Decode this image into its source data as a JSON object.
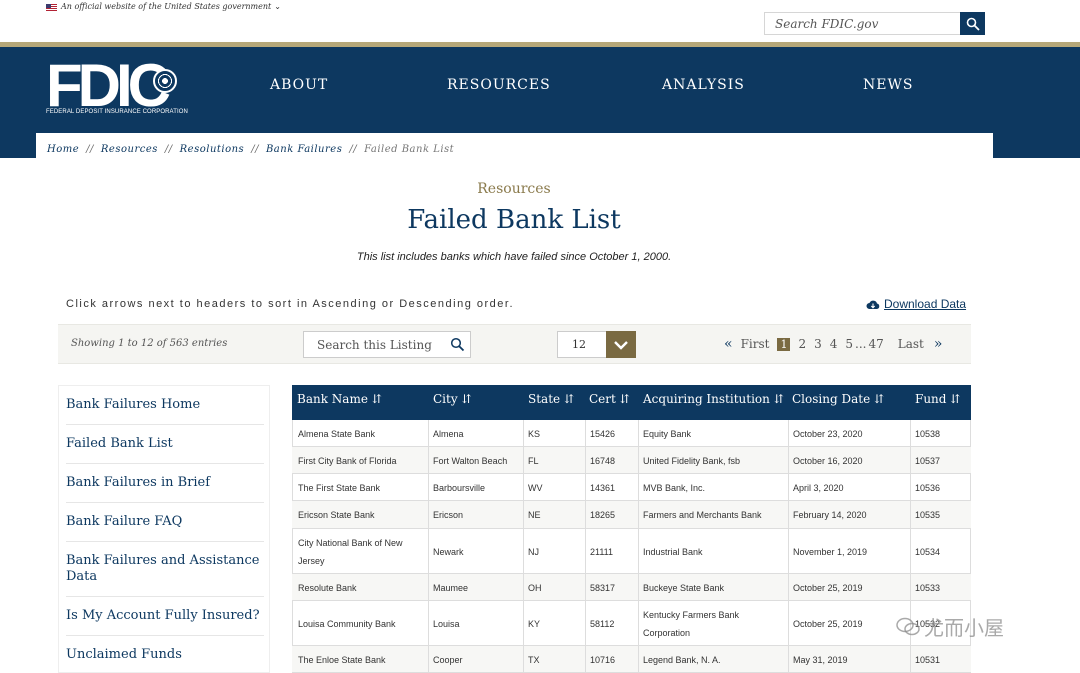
{
  "gov_banner": {
    "text": "An official website of the United States government"
  },
  "site_search": {
    "placeholder": "Search FDIC.gov"
  },
  "logo": {
    "letters": "FDIC",
    "subtitle": "FEDERAL DEPOSIT INSURANCE CORPORATION"
  },
  "nav": [
    "ABOUT",
    "RESOURCES",
    "ANALYSIS",
    "NEWS"
  ],
  "breadcrumb": [
    "Home",
    "Resources",
    "Resolutions",
    "Bank Failures",
    "Failed Bank List"
  ],
  "eyebrow": "Resources",
  "title": "Failed Bank List",
  "intro": "This list includes banks which have failed since October 1, 2000.",
  "sort_note": "Click arrows next to headers to sort in Ascending or Descending order.",
  "download_label": "Download Data",
  "showing": "Showing 1 to 12 of 563 entries",
  "listing_search": {
    "placeholder": "Search this Listing"
  },
  "per_page": "12",
  "pager": {
    "first": "First",
    "pages": [
      "1",
      "2",
      "3",
      "4",
      "5"
    ],
    "ellipsis": "...",
    "last_page": "47",
    "last": "Last"
  },
  "sidebar": [
    "Bank Failures Home",
    "Failed Bank List",
    "Bank Failures in Brief",
    "Bank Failure FAQ",
    "Bank Failures and Assistance Data",
    "Is My Account Fully Insured?",
    "Unclaimed Funds"
  ],
  "table": {
    "headers": [
      "Bank Name",
      "City",
      "State",
      "Cert",
      "Acquiring Institution",
      "Closing Date",
      "Fund"
    ],
    "rows": [
      [
        "Almena State Bank",
        "Almena",
        "KS",
        "15426",
        "Equity Bank",
        "October 23, 2020",
        "10538"
      ],
      [
        "First City Bank of Florida",
        "Fort Walton Beach",
        "FL",
        "16748",
        "United Fidelity Bank, fsb",
        "October 16, 2020",
        "10537"
      ],
      [
        "The First State Bank",
        "Barboursville",
        "WV",
        "14361",
        "MVB Bank, Inc.",
        "April 3, 2020",
        "10536"
      ],
      [
        "Ericson State Bank",
        "Ericson",
        "NE",
        "18265",
        "Farmers and Merchants Bank",
        "February 14, 2020",
        "10535"
      ],
      [
        "City National Bank of New Jersey",
        "Newark",
        "NJ",
        "21111",
        "Industrial Bank",
        "November 1, 2019",
        "10534"
      ],
      [
        "Resolute Bank",
        "Maumee",
        "OH",
        "58317",
        "Buckeye State Bank",
        "October 25, 2019",
        "10533"
      ],
      [
        "Louisa Community Bank",
        "Louisa",
        "KY",
        "58112",
        "Kentucky Farmers Bank Corporation",
        "October 25, 2019",
        "10532"
      ],
      [
        "The Enloe State Bank",
        "Cooper",
        "TX",
        "10716",
        "Legend Bank, N. A.",
        "May 31, 2019",
        "10531"
      ]
    ]
  },
  "watermark": "尤而小屋"
}
